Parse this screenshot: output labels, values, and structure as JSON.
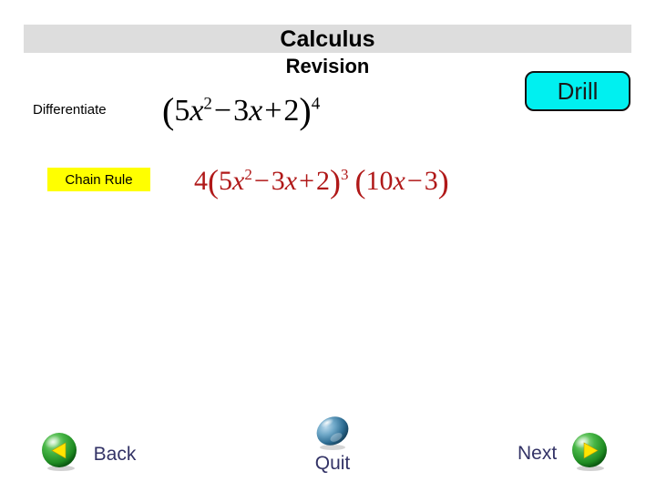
{
  "title": {
    "line1": "Calculus",
    "line2": "Revision",
    "band_color": "#dddddd"
  },
  "drill": {
    "label": "Drill",
    "fill_color": "#00f0f0",
    "border_color": "#111111"
  },
  "question": {
    "prompt": "Differentiate",
    "expression": {
      "open_paren": "(",
      "coef1": "5",
      "var1": "x",
      "exp1": "2",
      "op1": "−",
      "coef2": "3",
      "var2": "x",
      "op2": "+",
      "const": "2",
      "close_paren": ")",
      "power": "4"
    },
    "expression_text": "(5x² − 3x + 2)⁴"
  },
  "hint": {
    "label": "Chain Rule",
    "highlight_color": "#ffff00"
  },
  "answer": {
    "color": "#b01818",
    "expression": {
      "outer_coef": "4",
      "open_paren": "(",
      "coef1": "5",
      "var1": "x",
      "exp1": "2",
      "op1": "−",
      "coef2": "3",
      "var2": "x",
      "op2": "+",
      "const": "2",
      "close_paren": ")",
      "power": "3",
      "open_paren2": "(",
      "coef3": "10",
      "var3": "x",
      "op3": "−",
      "const2": "3",
      "close_paren2": ")"
    },
    "expression_text": "4(5x² − 3x + 2)³ (10x − 3)"
  },
  "navigation": {
    "back": {
      "label": "Back",
      "icon": "green-sphere-left-arrow-icon"
    },
    "quit": {
      "label": "Quit",
      "icon": "blue-sphere-icon"
    },
    "next": {
      "label": "Next",
      "icon": "green-sphere-right-arrow-icon"
    },
    "label_color": "#333366"
  }
}
